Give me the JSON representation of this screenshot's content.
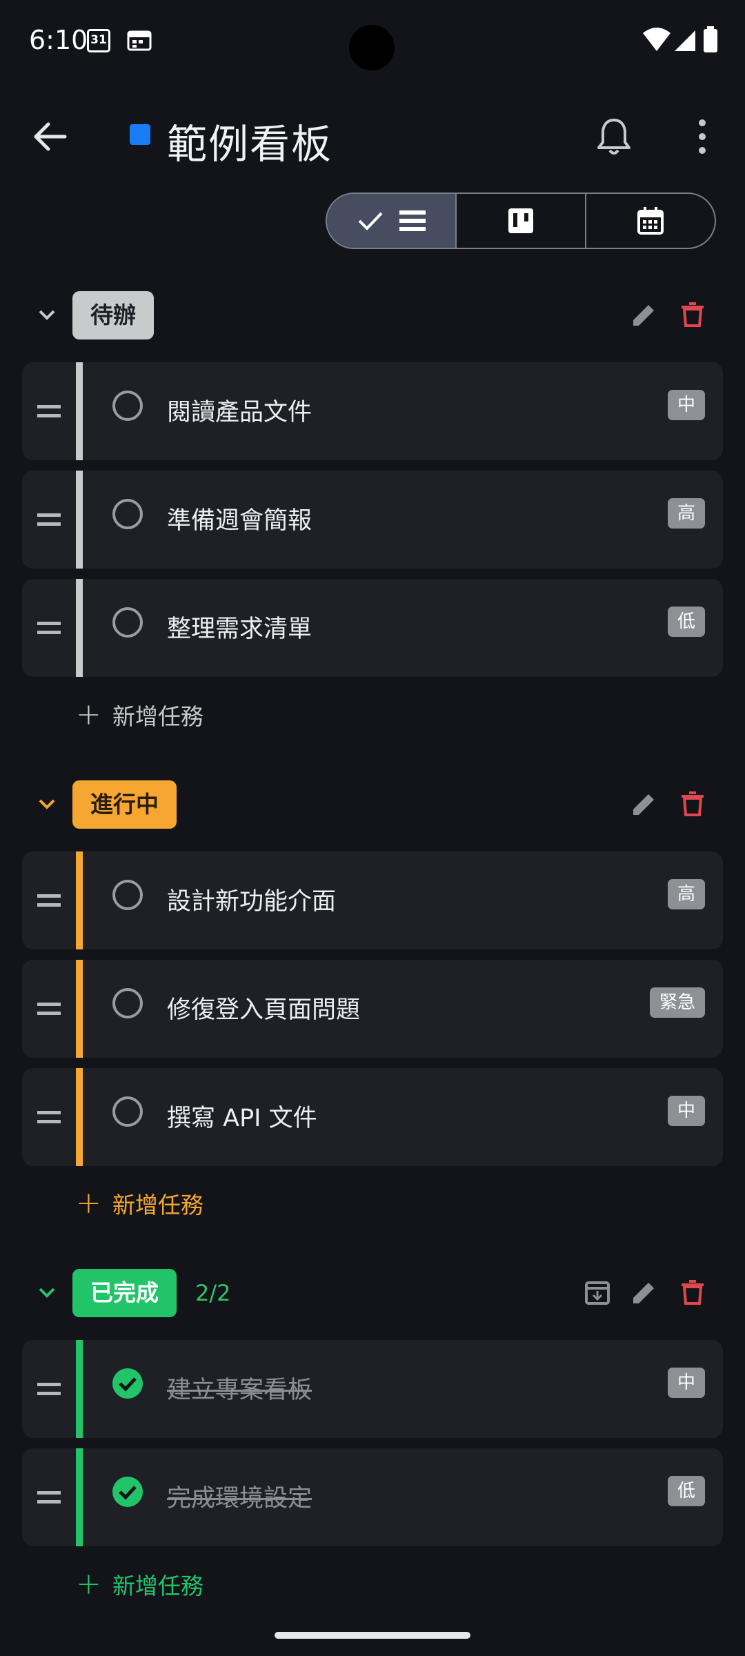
{
  "status_bar": {
    "time": "6:10",
    "calendar_day": "31",
    "icons": [
      "calendar-31-icon",
      "calendar-icon",
      "wifi-icon",
      "signal-icon",
      "battery-icon"
    ]
  },
  "app_bar": {
    "board_color": "#1a7cf4",
    "title": "範例看板",
    "icons": [
      "back-arrow-icon",
      "bell-icon",
      "more-vert-icon"
    ]
  },
  "view_toggle": {
    "options": [
      "list-view",
      "board-view",
      "calendar-view"
    ],
    "selected": "list-view"
  },
  "sections": [
    {
      "name": "待辦",
      "color": "#c9cacc",
      "label_text_color": "#1f2026",
      "count": "",
      "tasks": [
        {
          "title": "閱讀產品文件",
          "priority": "中",
          "done": false
        },
        {
          "title": "準備週會簡報",
          "priority": "高",
          "done": false
        },
        {
          "title": "整理需求清單",
          "priority": "低",
          "done": false
        }
      ],
      "add_label": "新增任務"
    },
    {
      "name": "進行中",
      "color": "#f6a731",
      "label_text_color": "#2a1c05",
      "count": "",
      "tasks": [
        {
          "title": "設計新功能介面",
          "priority": "高",
          "done": false
        },
        {
          "title": "修復登入頁面問題",
          "priority": "緊急",
          "done": false
        },
        {
          "title": "撰寫 API 文件",
          "priority": "中",
          "done": false
        }
      ],
      "add_label": "新增任務"
    },
    {
      "name": "已完成",
      "color": "#21c469",
      "label_text_color": "#ffffff",
      "count": "2/2",
      "tasks": [
        {
          "title": "建立專案看板",
          "priority": "中",
          "done": true
        },
        {
          "title": "完成環境設定",
          "priority": "低",
          "done": true
        }
      ],
      "add_label": "新增任務"
    }
  ],
  "colors": {
    "background": "#131419",
    "card": "#1f2026",
    "delete": "#e0474e",
    "icon_gray": "#9a9ca3"
  }
}
